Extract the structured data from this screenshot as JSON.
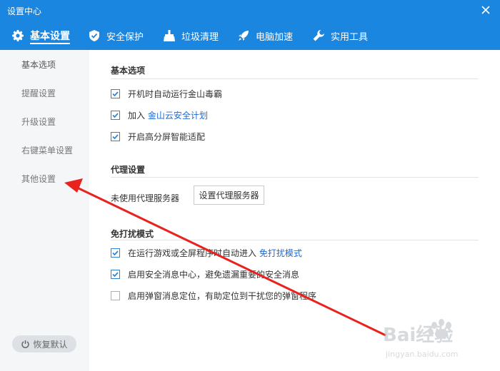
{
  "window": {
    "title": "设置中心"
  },
  "tabs": [
    {
      "label": "基本设置",
      "icon": "gear-icon",
      "active": true
    },
    {
      "label": "安全保护",
      "icon": "shield-icon"
    },
    {
      "label": "垃圾清理",
      "icon": "broom-icon"
    },
    {
      "label": "电脑加速",
      "icon": "rocket-icon"
    },
    {
      "label": "实用工具",
      "icon": "wrench-icon"
    }
  ],
  "sidebar": {
    "items": [
      {
        "label": "基本选项",
        "active": true
      },
      {
        "label": "提醒设置"
      },
      {
        "label": "升级设置"
      },
      {
        "label": "右键菜单设置"
      },
      {
        "label": "其他设置"
      }
    ],
    "restore_label": "恢复默认"
  },
  "basic": {
    "title": "基本选项",
    "options": [
      {
        "label": "开机时自动运行金山毒霸",
        "checked": true
      },
      {
        "label": "加入 ",
        "link": "金山云安全计划",
        "checked": true
      },
      {
        "label": "开启高分屏智能适配",
        "checked": true
      }
    ]
  },
  "proxy": {
    "title": "代理设置",
    "status": "未使用代理服务器",
    "button": "设置代理服务器"
  },
  "nodisturb": {
    "title": "免打扰模式",
    "options": [
      {
        "label": "在运行游戏或全屏程序时自动进入 ",
        "link": "免打扰模式",
        "checked": true
      },
      {
        "label": "启用安全消息中心，避免遗漏重要的安全消息",
        "checked": true
      },
      {
        "label": "启用弹窗消息定位，有助定位到干扰您的弹窗程序",
        "checked": false
      }
    ]
  },
  "watermark": {
    "text": "Bai经验",
    "url": "jingyan.baidu.com"
  },
  "colors": {
    "header": "#1a86e0",
    "sidebar": "#f4f6f8",
    "accent": "#2b84d6",
    "link": "#1a6ad6",
    "annotation": "#e8231f"
  }
}
